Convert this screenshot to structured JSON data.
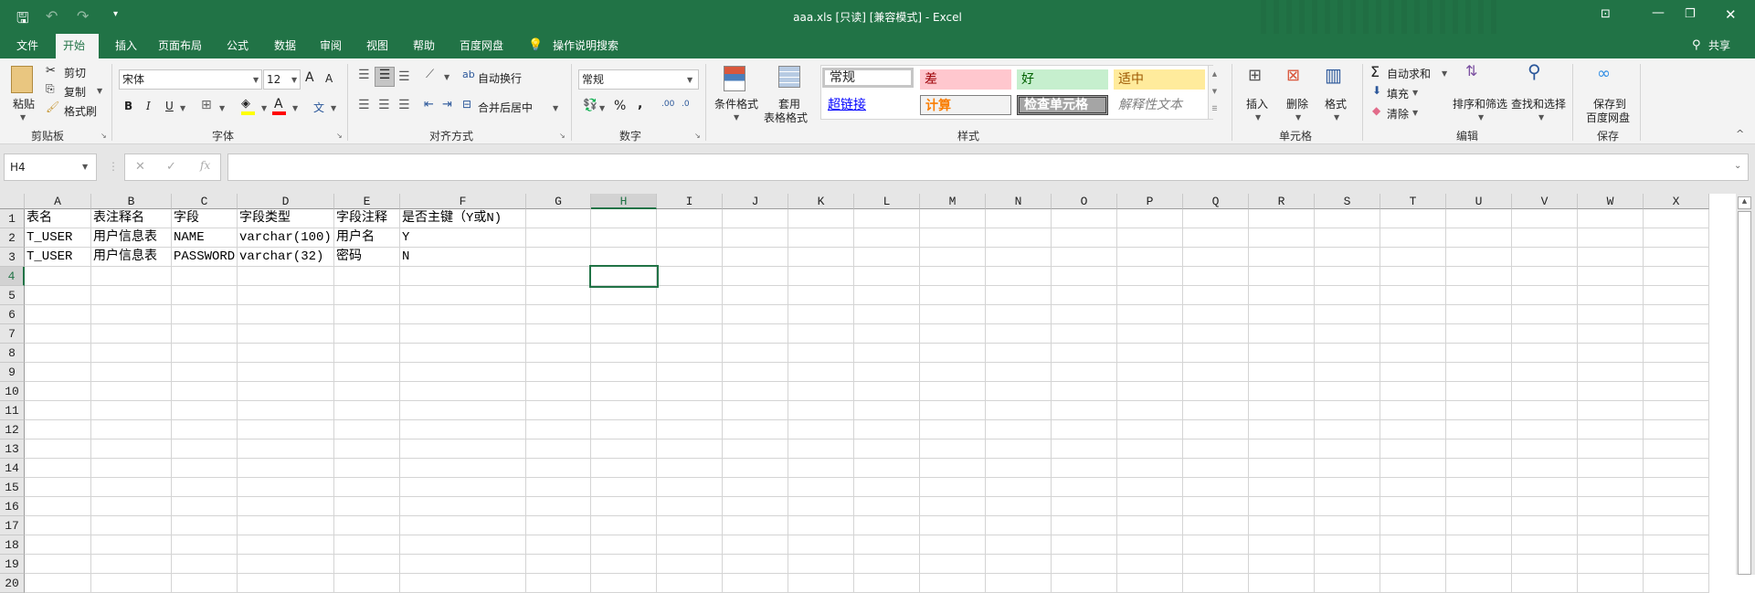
{
  "title": "aaa.xls  [只读]  [兼容模式]  -  Excel",
  "tabs": [
    "文件",
    "开始",
    "插入",
    "页面布局",
    "公式",
    "数据",
    "审阅",
    "视图",
    "帮助",
    "百度网盘"
  ],
  "active_tab": "开始",
  "tell_me": "操作说明搜索",
  "share": "共享",
  "clipboard": {
    "paste": "粘贴",
    "cut": "剪切",
    "copy": "复制",
    "format_painter": "格式刷",
    "label": "剪贴板"
  },
  "font": {
    "name": "宋体",
    "size": "12",
    "bold": "B",
    "italic": "I",
    "underline": "U",
    "grow": "A",
    "shrink": "A",
    "font_color": "A",
    "phonetic": "文",
    "label": "字体"
  },
  "alignment": {
    "wrap": "自动换行",
    "merge": "合并后居中",
    "label": "对齐方式"
  },
  "number": {
    "format": "常规",
    "percent": "%",
    "comma": ",",
    "inc": ".00",
    "dec": ".0",
    "label": "数字"
  },
  "styles": {
    "conditional": "条件格式",
    "table_line1": "套用",
    "table_line2": "表格格式",
    "normal": "常规",
    "bad": "差",
    "good": "好",
    "neutral": "适中",
    "hyperlink": "超链接",
    "calculation": "计算",
    "check_cell": "检查单元格",
    "explanatory": "解释性文本",
    "label": "样式"
  },
  "cells": {
    "insert": "插入",
    "delete": "删除",
    "format": "格式",
    "label": "单元格"
  },
  "editing": {
    "autosum": "自动求和",
    "fill": "填充",
    "clear": "清除",
    "sort": "排序和筛选",
    "find": "查找和选择",
    "label": "编辑"
  },
  "save": {
    "line1": "保存到",
    "line2": "百度网盘",
    "label": "保存"
  },
  "formula_bar": {
    "name_box": "H4",
    "cancel": "✕",
    "enter": "✓",
    "fx": "fx",
    "value": ""
  },
  "colors": {
    "accent": "#217346",
    "bad_bg": "#ffc7ce",
    "good_bg": "#c6efce",
    "neutral_bg": "#ffeb9c"
  },
  "sheet": {
    "columns": [
      "A",
      "B",
      "C",
      "D",
      "E",
      "F",
      "G",
      "H",
      "I",
      "J",
      "K",
      "L",
      "M",
      "N",
      "O",
      "P",
      "Q",
      "R",
      "S",
      "T",
      "U",
      "V",
      "W",
      "X"
    ],
    "selected_cell": "H4",
    "row_count": 20,
    "rows": [
      [
        "表名",
        "表注释名",
        "字段",
        "字段类型",
        "字段注释",
        "是否主键（Y或N)"
      ],
      [
        "T_USER",
        "用户信息表",
        "NAME",
        "varchar(100)",
        "用户名",
        "Y"
      ],
      [
        "T_USER",
        "用户信息表",
        "PASSWORD",
        "varchar(32)",
        "密码",
        "N"
      ]
    ]
  }
}
